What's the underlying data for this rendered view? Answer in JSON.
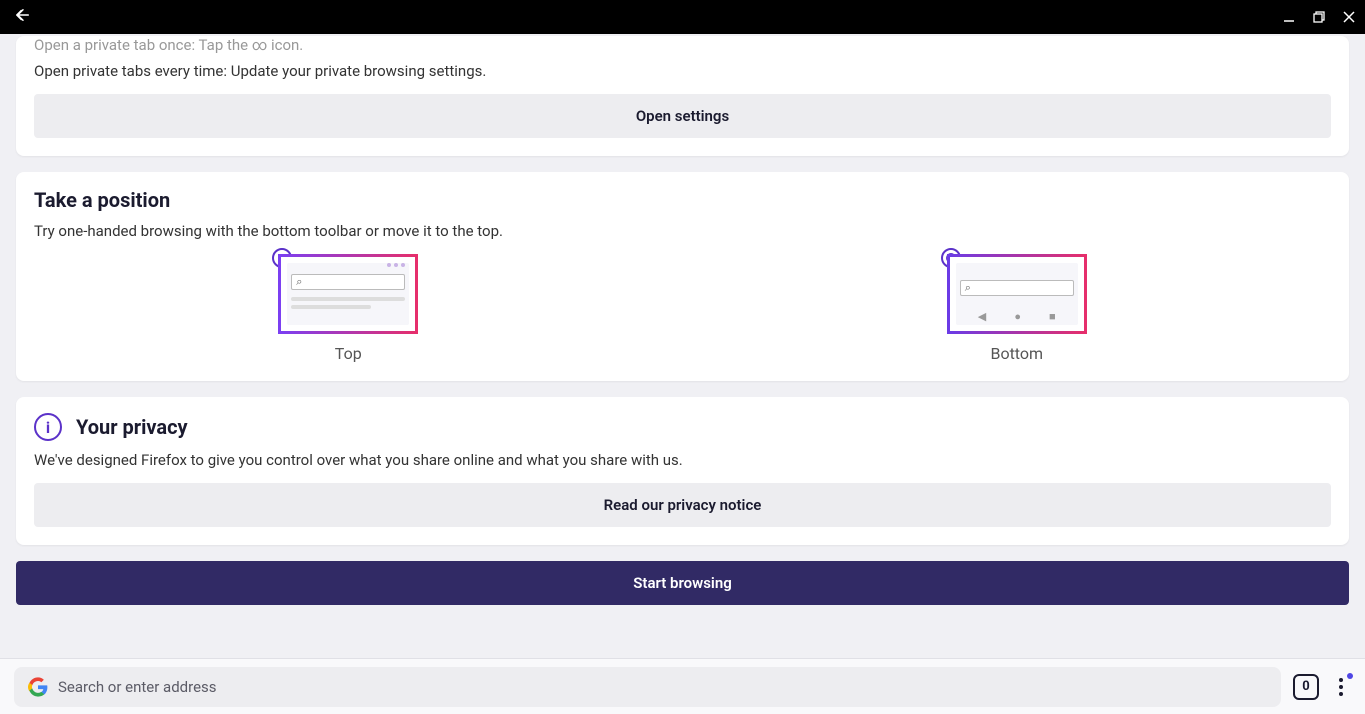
{
  "titlebar": {
    "back_icon": "←",
    "minimize": "—",
    "maximize": "❐",
    "close": "✕"
  },
  "private_card": {
    "line1_partial": "Open a private tab once: Tap the ∞ icon.",
    "line2": "Open private tabs every time: Update your private browsing settings.",
    "button": "Open settings"
  },
  "position_card": {
    "title": "Take a position",
    "body": "Try one-handed browsing with the bottom toolbar or move it to the top.",
    "option_top": "Top",
    "option_bottom": "Bottom",
    "selected": "bottom"
  },
  "privacy_card": {
    "title": "Your privacy",
    "body": "We've designed Firefox to give you control over what you share online and what you share with us.",
    "button": "Read our privacy notice"
  },
  "start_button": "Start browsing",
  "bottom_bar": {
    "placeholder": "Search or enter address",
    "tab_count": "0"
  }
}
